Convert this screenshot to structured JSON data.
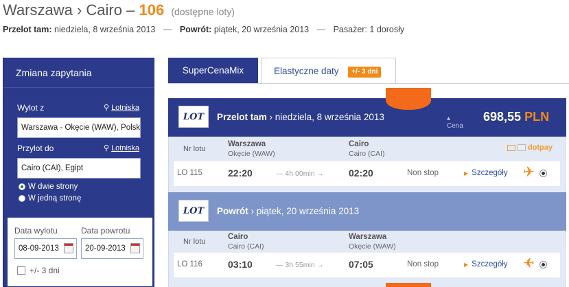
{
  "header": {
    "route": "Warszawa › Cairo –",
    "count": "106",
    "count_note": "(dostępne loty)"
  },
  "summary": {
    "outbound_label": "Przelot tam:",
    "outbound_date": "niedziela, 8 września 2013",
    "sep": "—",
    "return_label": "Powrót:",
    "return_date": "piątek, 20 września 2013",
    "pax_text": "Pasażer: 1 dorosły"
  },
  "sidebar": {
    "title": "Zmiana zapytania",
    "from_label": "Wylot z",
    "from_link": "Lotniska",
    "from_value": "Warszawa - Okęcie (WAW), Polska",
    "to_label": "Przylot do",
    "to_link": "Lotniska",
    "to_value": "Cairo (CAI), Egipt",
    "radio_roundtrip": "W dwie strony",
    "radio_oneway": "W jedną stronę",
    "depart_label": "Data wylotu",
    "return_label": "Data powrotu",
    "depart_value": "08-09-2013",
    "return_value": "20-09-2013",
    "flex_label": "+/- 3 dni"
  },
  "tabs": {
    "supercenamix": "SuperCenaMix",
    "elastyczne": "Elastyczne daty",
    "elastyczne_badge": "+/- 3 dni"
  },
  "outbound": {
    "airline_logo": "LOT",
    "title": "Przelot tam",
    "date": "› niedziela, 8 września 2013",
    "price_label": "Cena",
    "price": "698,55",
    "currency": "PLN",
    "col_flight": "Nr lotu",
    "from_city": "Warszawa",
    "from_airport": "Okęcie (WAW)",
    "to_city": "Cairo",
    "to_airport": "Cairo (CAI)",
    "pay_text": "dotpay",
    "flight_no": "LO 115",
    "dep_time": "22:20",
    "duration": "— 4h 00min →",
    "arr_time": "02:20",
    "stops": "Non stop",
    "details": "Szczegóły"
  },
  "inbound": {
    "airline_logo": "LOT",
    "title": "Powrót",
    "date": "› piątek, 20 września 2013",
    "col_flight": "Nr lotu",
    "from_city": "Cairo",
    "from_airport": "Cairo (CAI)",
    "to_city": "Warszawa",
    "to_airport": "Okęcie (WAW)",
    "flight_no": "LO 116",
    "dep_time": "03:10",
    "duration": "— 3h 55min →",
    "arr_time": "07:05",
    "stops": "Non stop",
    "details": "Szczegóły"
  },
  "colors": {
    "navy": "#2b3a8a",
    "accent": "#f28a1a",
    "light_panel": "#e3e9f5",
    "return_bar": "#7d95c8"
  }
}
